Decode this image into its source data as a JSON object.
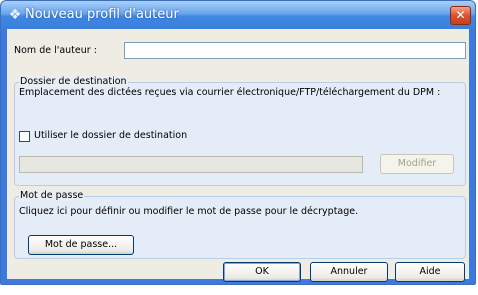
{
  "window": {
    "title": "Nouveau profil d'auteur",
    "icon": "app-icon",
    "close_icon": "close-icon"
  },
  "author": {
    "label": "Nom de l'auteur :",
    "value": ""
  },
  "destination_group": {
    "title": "Dossier de destination",
    "description": "Emplacement des dictées reçues via courrier électronique/FTP/téléchargement du DPM :",
    "checkbox_label": "Utiliser le dossier de destination",
    "checkbox_checked": false,
    "path_value": "",
    "modify_button": "Modifier"
  },
  "password_group": {
    "title": "Mot de passe",
    "description": "Cliquez ici pour définir ou modifier le mot de passe pour le décryptage.",
    "button": "Mot de passe..."
  },
  "footer": {
    "ok": "OK",
    "cancel": "Annuler",
    "help": "Aide"
  }
}
